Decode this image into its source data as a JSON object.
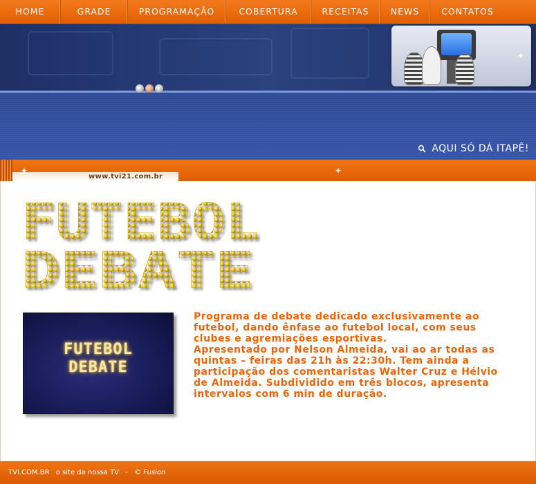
{
  "nav": {
    "items": [
      {
        "label": "HOME"
      },
      {
        "label": "GRADE"
      },
      {
        "label": "PROGRAMAÇÃO"
      },
      {
        "label": "COBERTURA"
      },
      {
        "label": "RECEITAS"
      },
      {
        "label": "NEWS"
      },
      {
        "label": "CONTATOS"
      }
    ]
  },
  "banner": {
    "slogan": "AQUI SÓ DÁ ITAPÊ!"
  },
  "strip": {
    "url": "www.tvi21.com.br"
  },
  "program": {
    "logo_line1": "FUTEBOL",
    "logo_line2": "DEBATE",
    "thumb_line1": "FUTEBOL",
    "thumb_line2": "DEBATE",
    "description_1": "Programa de debate dedicado exclusivamente ao futebol, dando ênfase ao futebol local, com seus clubes e agremiações esportivas.",
    "description_2": "Apresentado por Nelson Almeida, vai ao ar todas as quintas – feiras das 21h às 22:30h. Tem ainda a participação dos comentaristas Walter Cruz e Hélvio de Almeida. Subdividido em três blocos, apresenta intervalos com 6 min de duração."
  },
  "footer": {
    "site": "TVI.COM.BR",
    "tagline": "o site da nossa TV",
    "separator": "-",
    "credit": "© Fusion"
  },
  "colors": {
    "accent": "#e8650c",
    "nav": "#ef7013",
    "banner": "#2e4a96",
    "logo_dot": "#e6c41a"
  }
}
